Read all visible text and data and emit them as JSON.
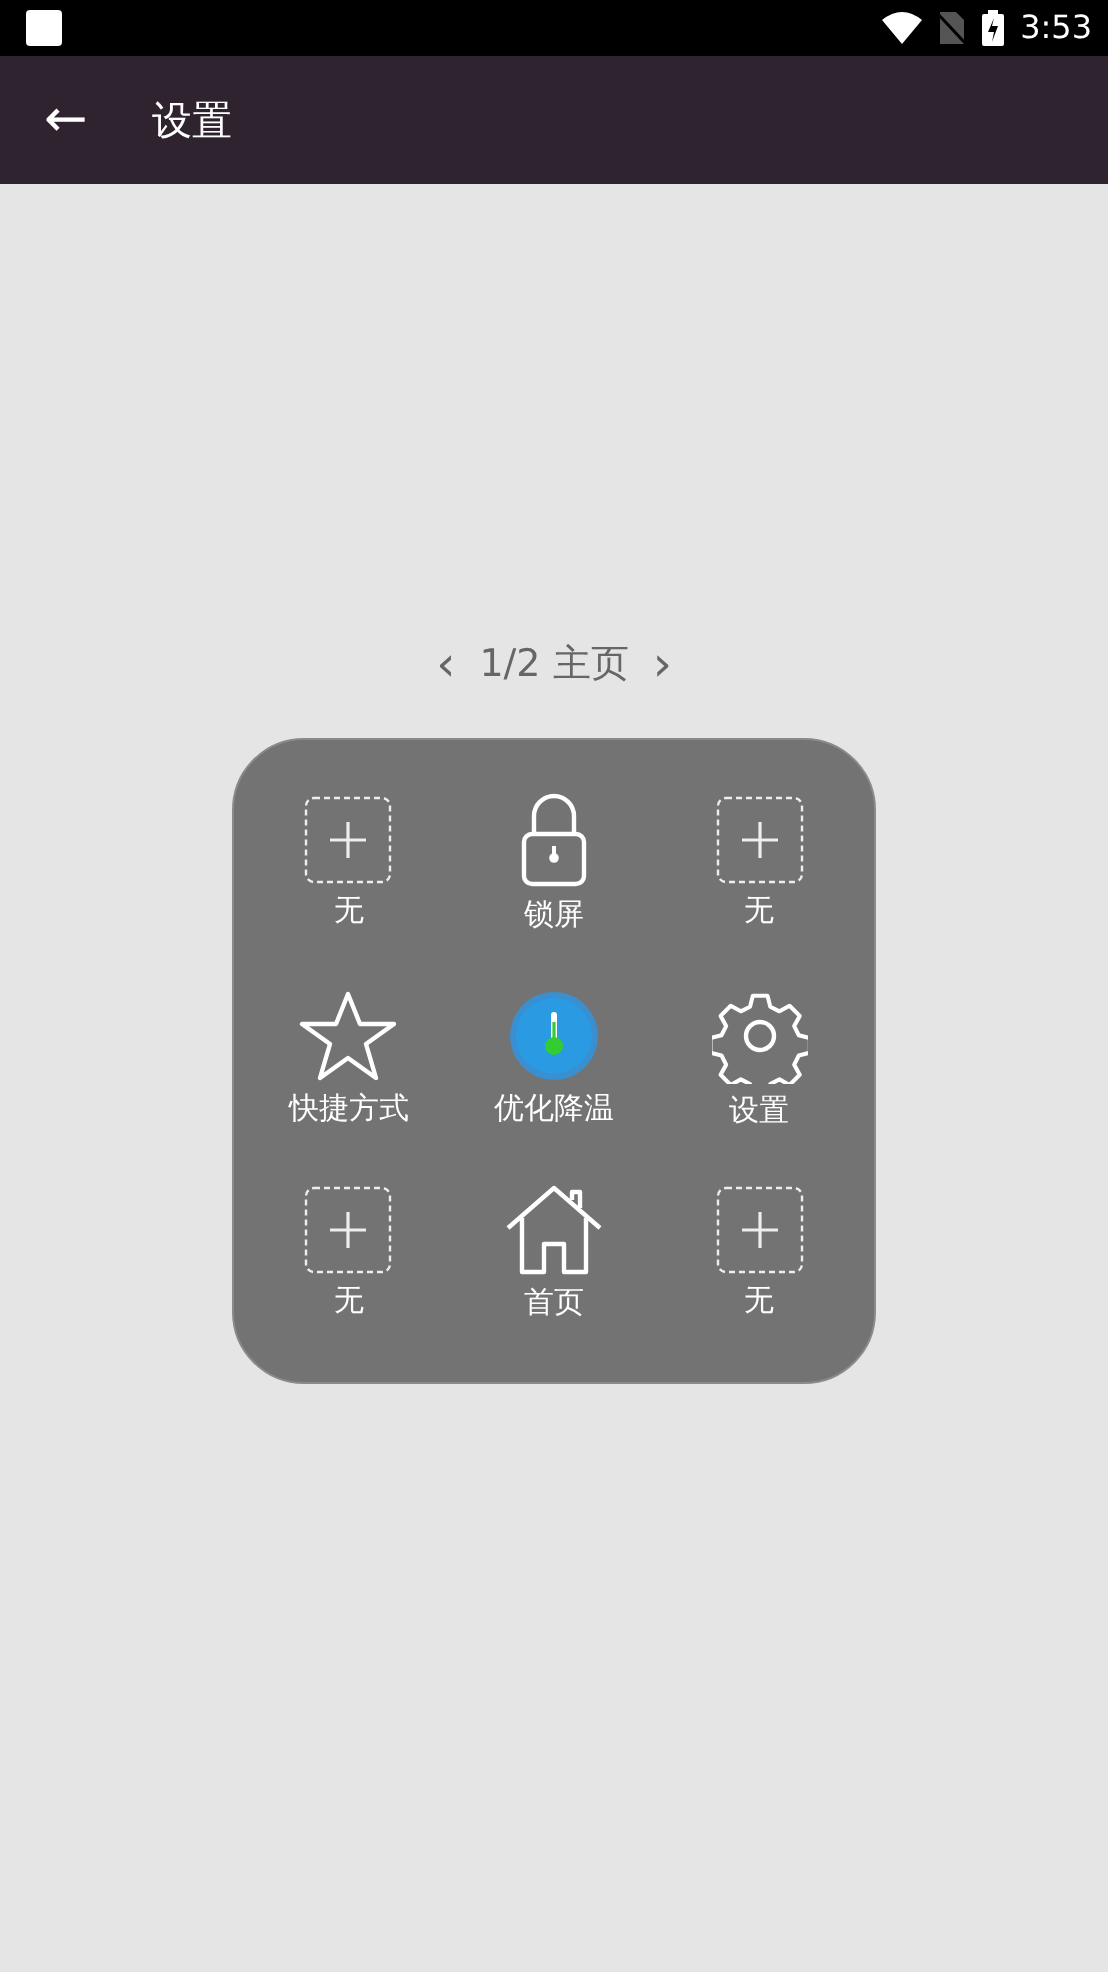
{
  "status_bar": {
    "time": "3:53"
  },
  "app_bar": {
    "back": "←",
    "title": "设置"
  },
  "pager": {
    "prev": "‹",
    "label": "1/2 主页",
    "next": "›"
  },
  "grid": [
    {
      "kind": "empty",
      "label": "无"
    },
    {
      "kind": "lock",
      "label": "锁屏"
    },
    {
      "kind": "empty",
      "label": "无"
    },
    {
      "kind": "star",
      "label": "快捷方式"
    },
    {
      "kind": "thermo",
      "label": "优化降温"
    },
    {
      "kind": "gear",
      "label": "设置"
    },
    {
      "kind": "empty",
      "label": "无"
    },
    {
      "kind": "home",
      "label": "首页"
    },
    {
      "kind": "empty",
      "label": "无"
    }
  ]
}
